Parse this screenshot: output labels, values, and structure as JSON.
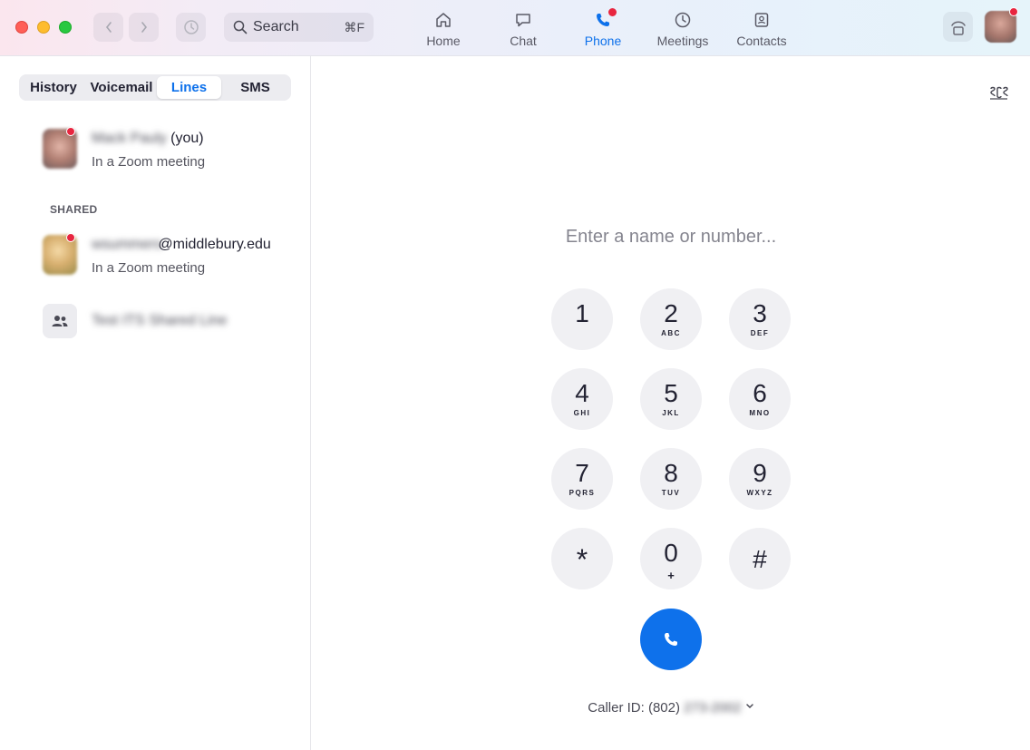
{
  "window": {
    "search": {
      "label": "Search",
      "shortcut": "⌘F"
    },
    "tabs": [
      {
        "label": "Home",
        "icon": "home-icon",
        "active": false
      },
      {
        "label": "Chat",
        "icon": "chat-icon",
        "active": false
      },
      {
        "label": "Phone",
        "icon": "phone-icon",
        "active": true,
        "badge": "red-dot"
      },
      {
        "label": "Meetings",
        "icon": "clock-icon",
        "active": false
      },
      {
        "label": "Contacts",
        "icon": "contacts-icon",
        "active": false
      }
    ]
  },
  "sidebar": {
    "segments": [
      "History",
      "Voicemail",
      "Lines",
      "SMS"
    ],
    "active_segment": "Lines",
    "my_line": {
      "name_blurred": "Mack Pauly",
      "suffix": "(you)",
      "status": "In a Zoom meeting"
    },
    "shared_label": "SHARED",
    "shared_lines": [
      {
        "name_blurred": "wsummers",
        "domain": "@middlebury.edu",
        "status": "In a Zoom meeting"
      },
      {
        "name_blurred": "Test ITS Shared Line",
        "icon": "group-icon"
      }
    ]
  },
  "dialer": {
    "placeholder": "Enter a name or number...",
    "keys": [
      {
        "digit": "1",
        "letters": ""
      },
      {
        "digit": "2",
        "letters": "ABC"
      },
      {
        "digit": "3",
        "letters": "DEF"
      },
      {
        "digit": "4",
        "letters": "GHI"
      },
      {
        "digit": "5",
        "letters": "JKL"
      },
      {
        "digit": "6",
        "letters": "MNO"
      },
      {
        "digit": "7",
        "letters": "PQRS"
      },
      {
        "digit": "8",
        "letters": "TUV"
      },
      {
        "digit": "9",
        "letters": "WXYZ"
      },
      {
        "digit": "*",
        "letters": ""
      },
      {
        "digit": "0",
        "letters": "+"
      },
      {
        "digit": "#",
        "letters": ""
      }
    ],
    "caller_id_label": "Caller ID: (802)",
    "caller_id_blurred": "273-2002",
    "colors": {
      "accent": "#0e71eb",
      "badge": "#e8253f"
    }
  }
}
